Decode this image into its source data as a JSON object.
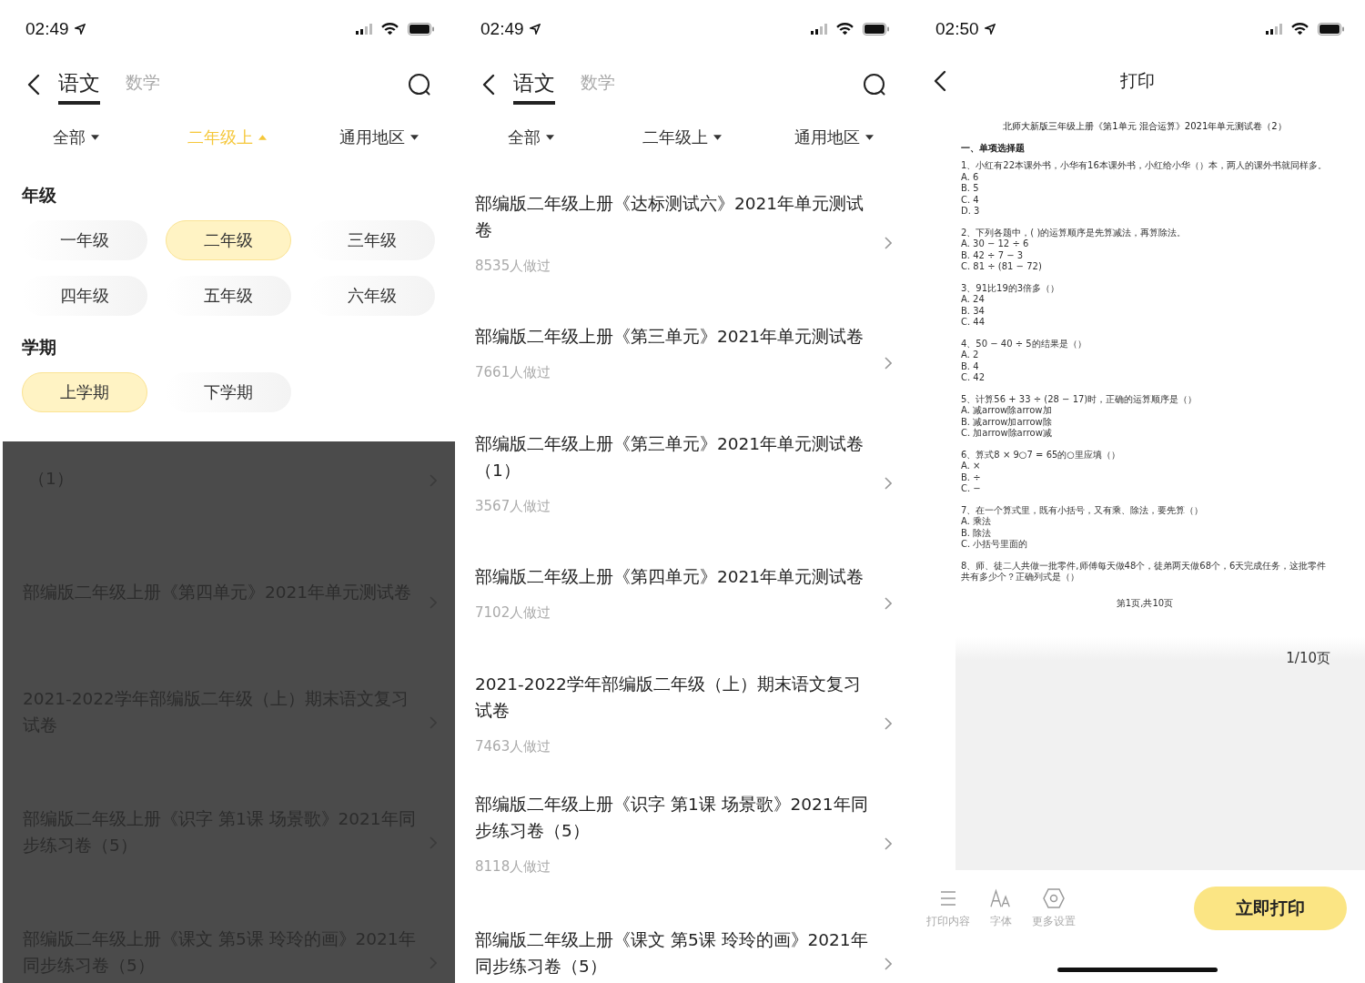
{
  "screens": [
    {
      "kind": "filter",
      "status_bar": {
        "time": "02:49"
      },
      "tabs": [
        {
          "label": "语文",
          "selected": true
        },
        {
          "label": "数学",
          "selected": false
        }
      ],
      "filters": [
        {
          "label": "全部",
          "selected": false,
          "expanded": false
        },
        {
          "label": "二年级上",
          "selected": true,
          "expanded": true
        },
        {
          "label": "通用地区",
          "selected": false,
          "expanded": false
        }
      ],
      "filter_panel": [
        {
          "title": "年级",
          "options": [
            {
              "label": "一年级",
              "selected": false
            },
            {
              "label": "二年级",
              "selected": true
            },
            {
              "label": "三年级",
              "selected": false
            },
            {
              "label": "四年级",
              "selected": false
            },
            {
              "label": "五年级",
              "selected": false
            },
            {
              "label": "六年级",
              "selected": false
            }
          ]
        },
        {
          "title": "学期",
          "options": [
            {
              "label": "上学期",
              "selected": true
            },
            {
              "label": "下学期",
              "selected": false
            }
          ]
        }
      ],
      "list": {
        "dimmed": true,
        "items": [
          {
            "title": "（1）"
          },
          {
            "title": "部编版二年级上册《第四单元》2021年单元测试卷"
          },
          {
            "title": "2021-2022学年部编版二年级（上）期末语文复习试卷"
          },
          {
            "title": "部编版二年级上册《识字 第1课 场景歌》2021年同步练习卷（5）"
          },
          {
            "title": "部编版二年级上册《课文 第5课 玲玲的画》2021年同步练习卷（5）"
          }
        ]
      }
    },
    {
      "kind": "list",
      "status_bar": {
        "time": "02:49"
      },
      "tabs": [
        {
          "label": "语文",
          "selected": true
        },
        {
          "label": "数学",
          "selected": false
        }
      ],
      "filters": [
        {
          "label": "全部",
          "selected": false,
          "expanded": false
        },
        {
          "label": "二年级上",
          "selected": false,
          "expanded": false
        },
        {
          "label": "通用地区",
          "selected": false,
          "expanded": false
        }
      ],
      "list": {
        "dimmed": false,
        "items": [
          {
            "title": "部编版二年级上册《达标测试六》2021年单元测试卷",
            "count": "8535人做过"
          },
          {
            "title": "部编版二年级上册《第三单元》2021年单元测试卷",
            "count": "7661人做过"
          },
          {
            "title": "部编版二年级上册《第三单元》2021年单元测试卷（1）",
            "count": "3567人做过"
          },
          {
            "title": "部编版二年级上册《第四单元》2021年单元测试卷",
            "count": "7102人做过"
          },
          {
            "title": "2021-2022学年部编版二年级（上）期末语文复习试卷",
            "count": "7463人做过"
          },
          {
            "title": "部编版二年级上册《识字 第1课 场景歌》2021年同步练习卷（5）",
            "count": "8118人做过"
          },
          {
            "title": "部编版二年级上册《课文 第5课 玲玲的画》2021年同步练习卷（5）"
          }
        ]
      }
    },
    {
      "kind": "print",
      "status_bar": {
        "time": "02:50"
      },
      "title": "打印",
      "document": {
        "title": "北师大新版三年级上册《第1单元 混合运算》2021年单元测试卷（2）",
        "section": "一、单项选择题",
        "questions": [
          {
            "text": "1、小红有22本课外书，小华有16本课外书，小红给小华（）本，两人的课外书就同样多。",
            "options": [
              "A. 6",
              "B. 5",
              "C. 4",
              "D. 3"
            ]
          },
          {
            "text": "2、下列各题中，( )的运算顺序是先算减法，再算除法。",
            "options": [
              "A. 30 − 12 ÷ 6",
              "B. 42 ÷ 7 − 3",
              "C. 81 ÷ (81 − 72)"
            ]
          },
          {
            "text": "3、91比19的3倍多（）",
            "options": [
              "A. 24",
              "B. 34",
              "C. 44"
            ]
          },
          {
            "text": "4、50 − 40 ÷ 5的结果是（）",
            "options": [
              "A. 2",
              "B. 4",
              "C. 42"
            ]
          },
          {
            "text": "5、计算56 + 33 ÷ (28 − 17)时，正确的运算顺序是（）",
            "options": [
              "A. 减arrow除arrow加",
              "B. 减arrow加arrow除",
              "C. 加arrow除arrow减"
            ]
          },
          {
            "text": "6、算式8 × 9○7 = 65的○里应填（）",
            "options": [
              "A. ×",
              "B. ÷",
              "C. −"
            ]
          },
          {
            "text": "7、在一个算式里，既有小括号，又有乘、除法，要先算（）",
            "options": [
              "A. 乘法",
              "B. 除法",
              "C. 小括号里面的"
            ]
          },
          {
            "text": "8、师、徒二人共做一批零件,师傅每天做48个，徒弟两天做68个，6天完成任务，这批零件共有多少个？正确列式是（）"
          }
        ],
        "footer": "第1页,共10页"
      },
      "page_indicator": "1/10页",
      "toolbar": [
        {
          "label": "打印内容",
          "kind": "list"
        },
        {
          "label": "字体",
          "kind": "font"
        },
        {
          "label": "更多设置",
          "kind": "settings"
        }
      ],
      "print_button": "立即打印"
    }
  ]
}
